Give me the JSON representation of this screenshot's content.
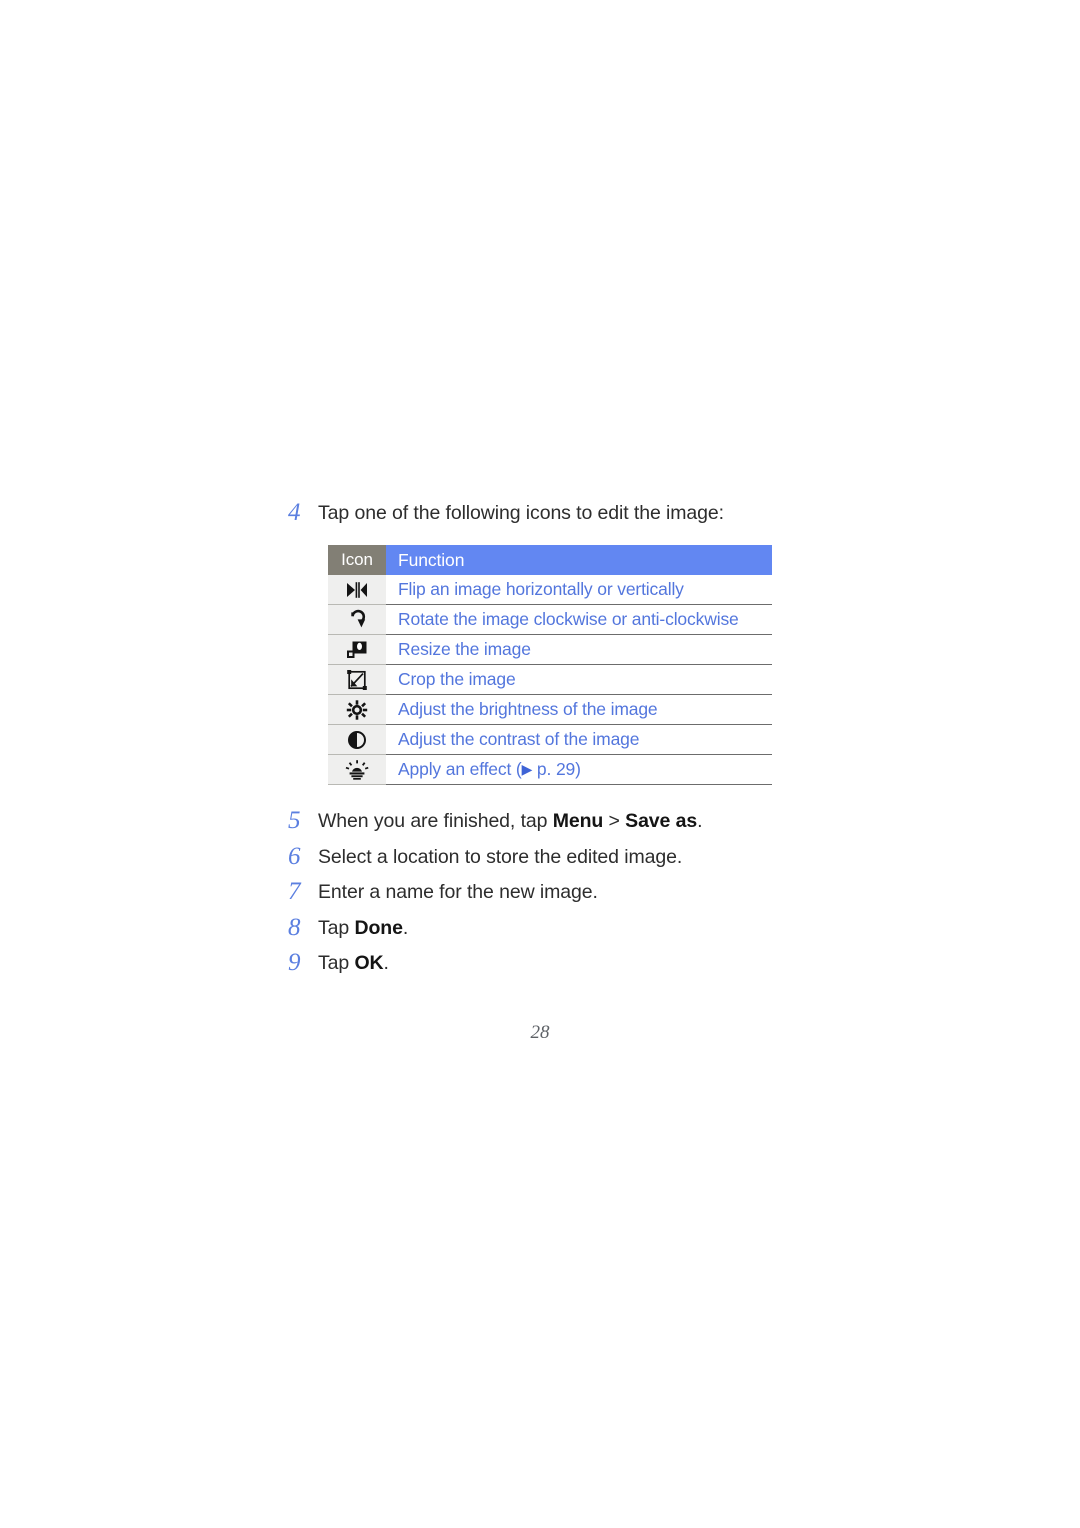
{
  "page": {
    "number": "28"
  },
  "steps": {
    "intro": {
      "num": "4",
      "text": "Tap one of the following icons to edit the image:"
    },
    "items": [
      {
        "num": "5",
        "pre": "When you are finished, tap ",
        "bold1": "Menu",
        "mid": " > ",
        "bold2": "Save as",
        "post": "."
      },
      {
        "num": "6",
        "pre": "Select a location to store the edited image.",
        "bold1": "",
        "mid": "",
        "bold2": "",
        "post": ""
      },
      {
        "num": "7",
        "pre": "Enter a name for the new image.",
        "bold1": "",
        "mid": "",
        "bold2": "",
        "post": ""
      },
      {
        "num": "8",
        "pre": "Tap ",
        "bold1": "Done",
        "mid": "",
        "bold2": "",
        "post": "."
      },
      {
        "num": "9",
        "pre": "Tap ",
        "bold1": "OK",
        "mid": "",
        "bold2": "",
        "post": "."
      }
    ]
  },
  "table": {
    "headers": {
      "icon": "Icon",
      "function": "Function"
    },
    "rows": [
      {
        "icon_name": "flip-icon",
        "function": "Flip an image horizontally or vertically",
        "arrow": "",
        "suffix": ""
      },
      {
        "icon_name": "rotate-icon",
        "function": "Rotate the image clockwise or anti-clockwise",
        "arrow": "",
        "suffix": ""
      },
      {
        "icon_name": "resize-icon",
        "function": "Resize the image",
        "arrow": "",
        "suffix": ""
      },
      {
        "icon_name": "crop-icon",
        "function": "Crop the image",
        "arrow": "",
        "suffix": ""
      },
      {
        "icon_name": "brightness-icon",
        "function": "Adjust the brightness of the image",
        "arrow": "",
        "suffix": ""
      },
      {
        "icon_name": "contrast-icon",
        "function": "Adjust the contrast of the image",
        "arrow": "",
        "suffix": ""
      },
      {
        "icon_name": "effect-icon",
        "function": "Apply an effect (",
        "arrow": "▶",
        "suffix": " p. 29)"
      }
    ]
  },
  "colors": {
    "header_icon_bg": "#827f75",
    "header_function_bg": "#6287f2",
    "link_blue": "#5376dd",
    "step_number_blue": "#5b7fe0",
    "icon_cell_bg": "#efefee",
    "body_text": "#2d2d2d",
    "folio_gray": "#5d6166"
  }
}
